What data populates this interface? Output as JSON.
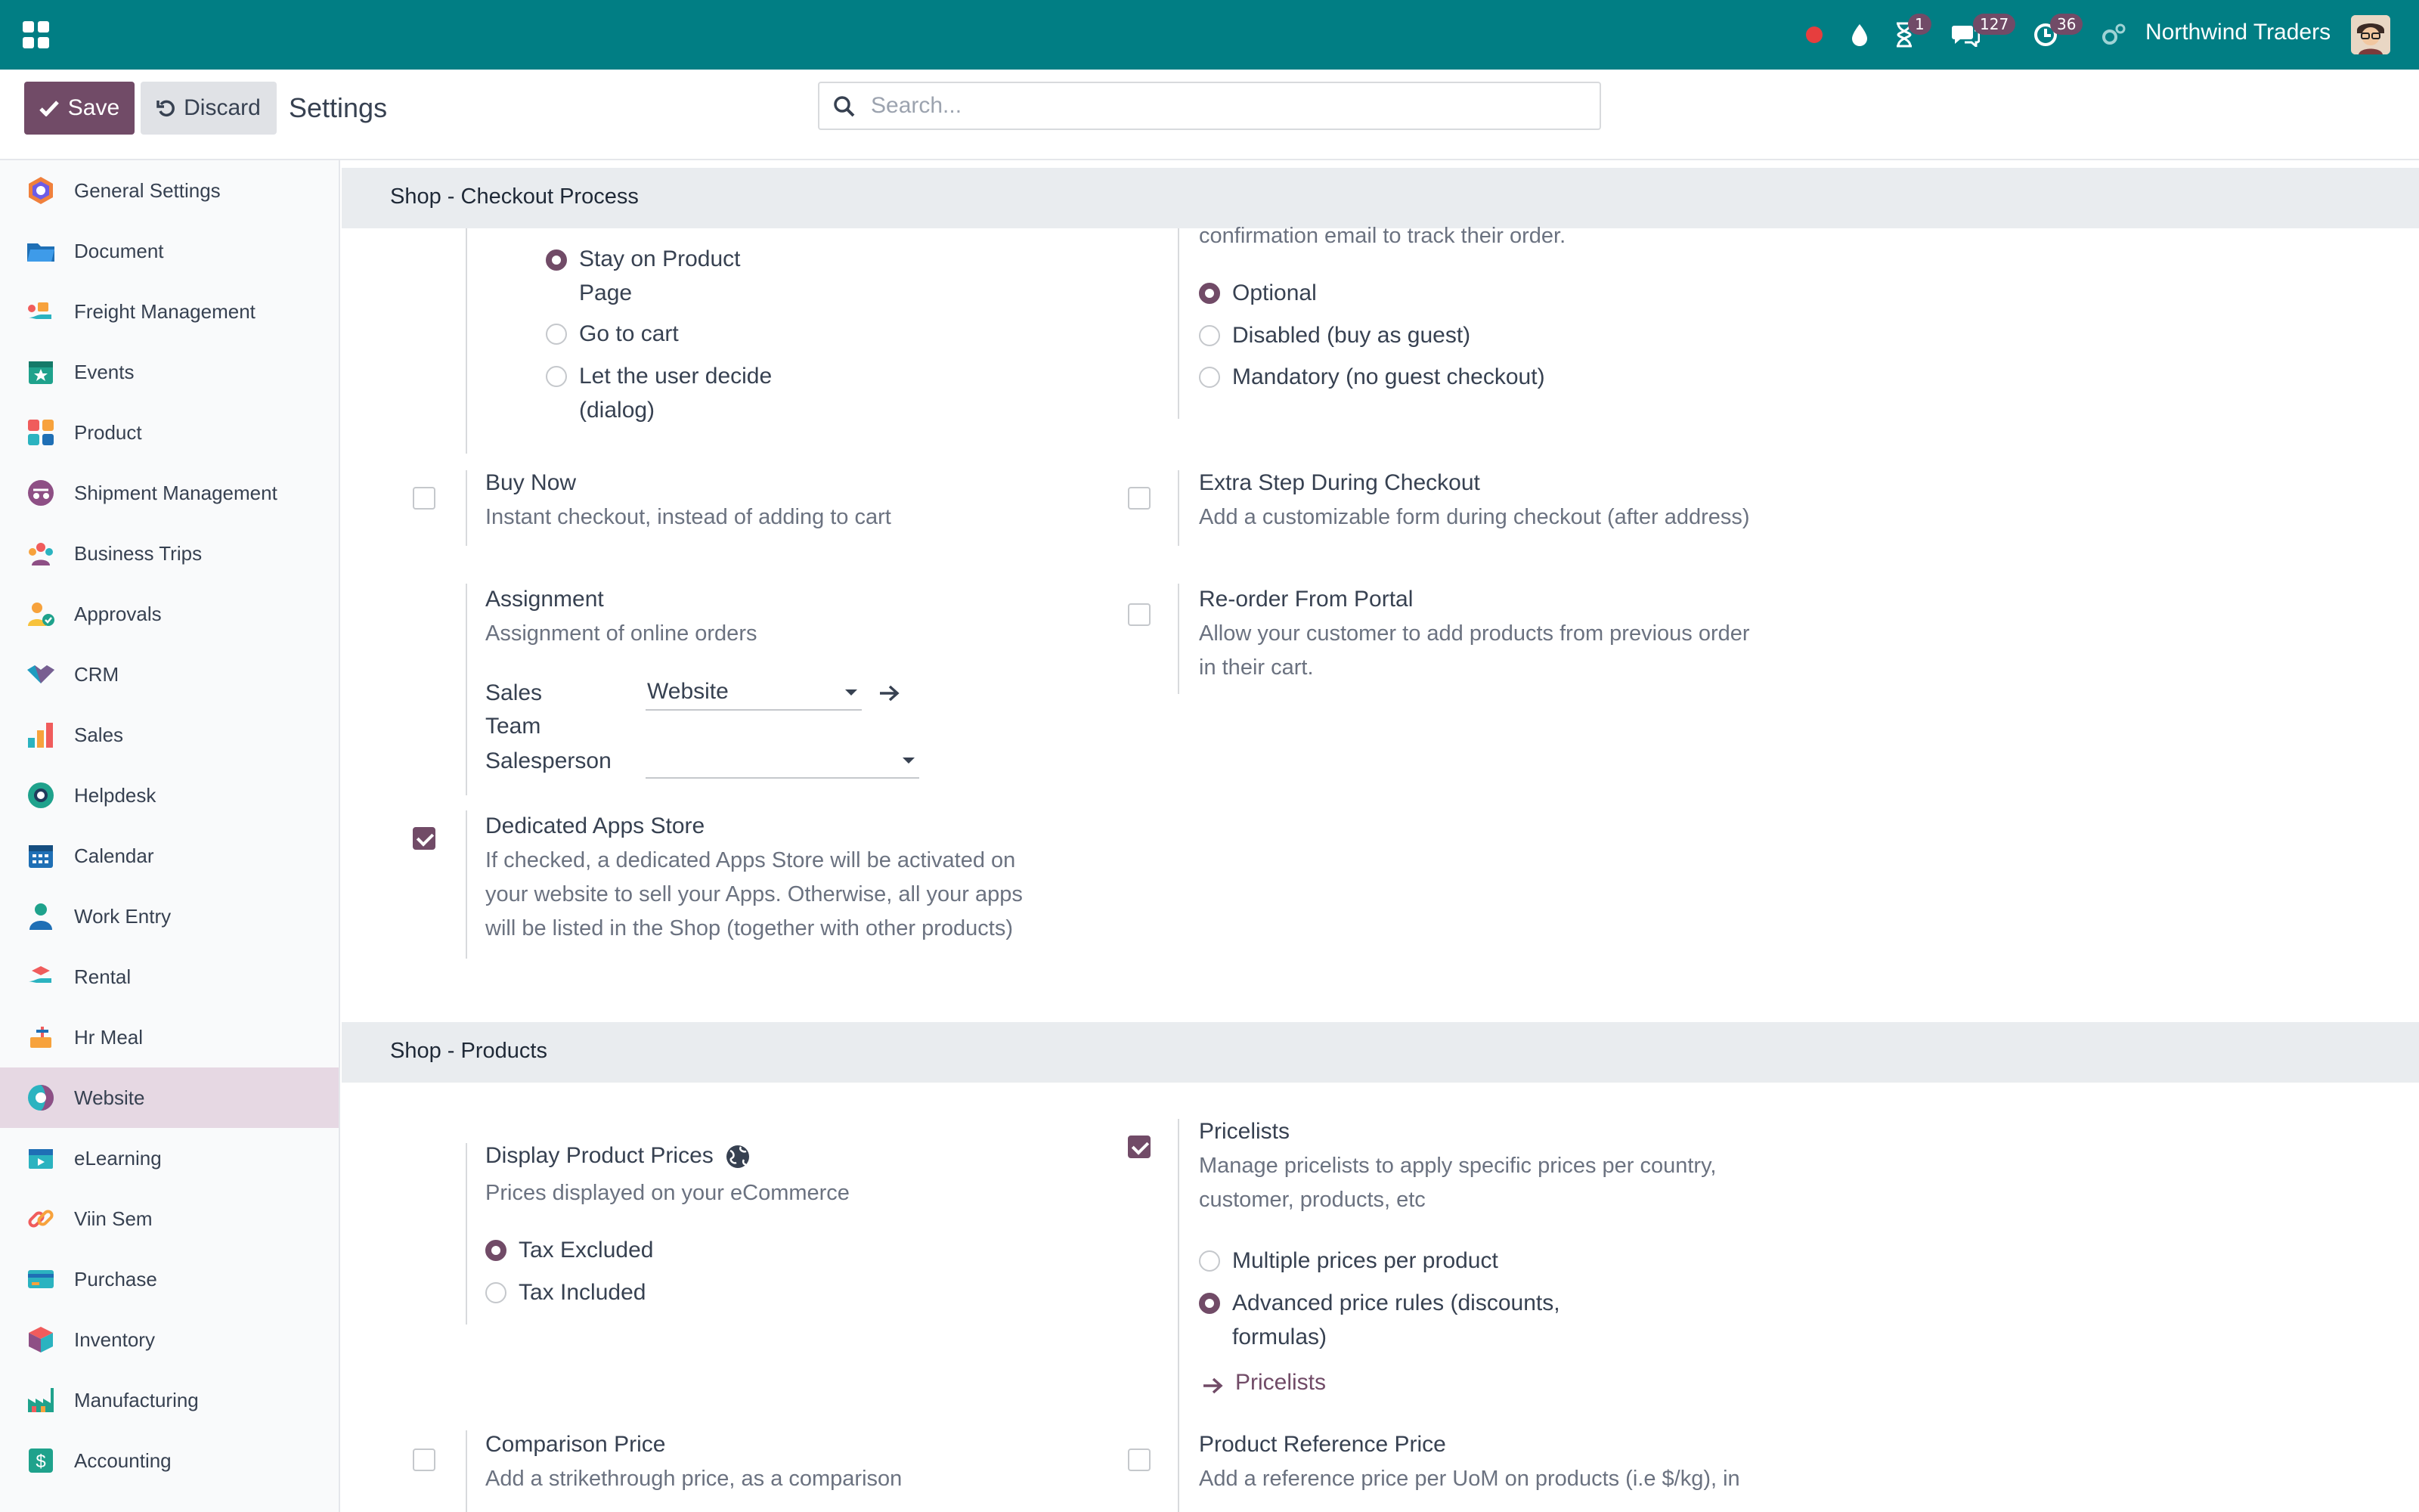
{
  "topbar": {
    "company": "Northwind Traders",
    "activities_count": "1",
    "messages_count": "127",
    "timesheet_count": "36",
    "accent": "#017e84"
  },
  "control": {
    "save_label": "Save",
    "discard_label": "Discard",
    "title": "Settings",
    "search_placeholder": "Search..."
  },
  "sidebar": {
    "items": [
      {
        "label": "General Settings",
        "icon": "general-settings-icon"
      },
      {
        "label": "Document",
        "icon": "folder-icon"
      },
      {
        "label": "Freight Management",
        "icon": "freight-icon"
      },
      {
        "label": "Events",
        "icon": "calendar-star-icon"
      },
      {
        "label": "Product",
        "icon": "product-grid-icon"
      },
      {
        "label": "Shipment Management",
        "icon": "shipment-icon"
      },
      {
        "label": "Business Trips",
        "icon": "team-icon"
      },
      {
        "label": "Approvals",
        "icon": "approval-icon"
      },
      {
        "label": "CRM",
        "icon": "handshake-icon"
      },
      {
        "label": "Sales",
        "icon": "bar-chart-icon"
      },
      {
        "label": "Helpdesk",
        "icon": "lifebuoy-icon"
      },
      {
        "label": "Calendar",
        "icon": "calendar-icon"
      },
      {
        "label": "Work Entry",
        "icon": "person-icon"
      },
      {
        "label": "Rental",
        "icon": "rental-icon"
      },
      {
        "label": "Hr Meal",
        "icon": "meal-icon"
      },
      {
        "label": "Website",
        "icon": "website-icon"
      },
      {
        "label": "eLearning",
        "icon": "elearning-icon"
      },
      {
        "label": "Viin Sem",
        "icon": "link-icon"
      },
      {
        "label": "Purchase",
        "icon": "credit-card-icon"
      },
      {
        "label": "Inventory",
        "icon": "box-icon"
      },
      {
        "label": "Manufacturing",
        "icon": "factory-icon"
      },
      {
        "label": "Accounting",
        "icon": "accounting-icon"
      }
    ],
    "active": "Website"
  },
  "checkout": {
    "section_title": "Shop - Checkout Process",
    "add_to_cart_options": [
      "Stay on Product",
      "Page",
      "Go to cart",
      "Let the user decide",
      "(dialog)"
    ],
    "signin_desc_tail": "confirmation email to track their order.",
    "signin_options": [
      "Optional",
      "Disabled (buy as guest)",
      "Mandatory (no guest checkout)"
    ],
    "buy_now_title": "Buy Now",
    "buy_now_desc": "Instant checkout, instead of adding to cart",
    "extra_step_title": "Extra Step During Checkout",
    "extra_step_desc": "Add a customizable form during checkout (after address)",
    "assignment_title": "Assignment",
    "assignment_desc": "Assignment of online orders",
    "sales_team_label_1": "Sales",
    "sales_team_label_2": "Team",
    "sales_team_value": "Website",
    "salesperson_label": "Salesperson",
    "salesperson_value": "",
    "reorder_title": "Re-order From Portal",
    "reorder_desc_1": "Allow your customer to add products from previous order",
    "reorder_desc_2": "in their cart.",
    "apps_store_title": "Dedicated Apps Store",
    "apps_store_desc_1": "If checked, a dedicated Apps Store will be activated on",
    "apps_store_desc_2": "your website to sell your Apps. Otherwise, all your apps",
    "apps_store_desc_3": "will be listed in the Shop (together with other products)"
  },
  "products": {
    "section_title": "Shop - Products",
    "display_prices_title": "Display Product Prices",
    "display_prices_desc": "Prices displayed on your eCommerce",
    "tax_options": [
      "Tax Excluded",
      "Tax Included"
    ],
    "pricelists_title": "Pricelists",
    "pricelists_desc_1": "Manage pricelists to apply specific prices per country,",
    "pricelists_desc_2": "customer, products, etc",
    "pricelist_options": [
      "Multiple prices per product",
      "Advanced price rules (discounts,",
      "formulas)"
    ],
    "pricelists_link": "Pricelists",
    "comparison_title": "Comparison Price",
    "comparison_desc": "Add a strikethrough price, as a comparison",
    "reference_title": "Product Reference Price",
    "reference_desc": "Add a reference price per UoM on products (i.e $/kg), in"
  }
}
